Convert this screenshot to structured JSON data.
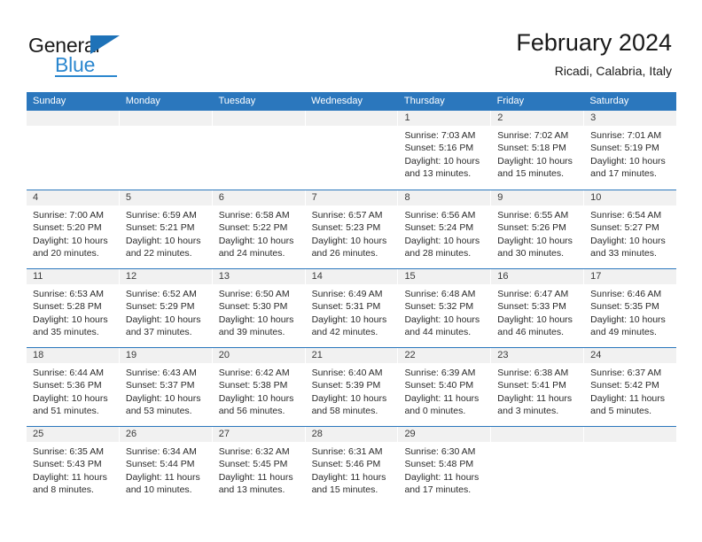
{
  "brand": {
    "name_part1": "General",
    "name_part2": "Blue",
    "triangle_color": "#1e72b8",
    "blue_color": "#2b87cf"
  },
  "header": {
    "title": "February 2024",
    "subtitle": "Ricadi, Calabria, Italy"
  },
  "theme": {
    "header_blue": "#2b77bd",
    "day_band_gray": "#f1f1f1",
    "cell_white": "#ffffff"
  },
  "weekdays": [
    "Sunday",
    "Monday",
    "Tuesday",
    "Wednesday",
    "Thursday",
    "Friday",
    "Saturday"
  ],
  "weeks": [
    [
      {
        "day": "",
        "sunrise": "",
        "sunset": "",
        "daylight": "",
        "daylight2": ""
      },
      {
        "day": "",
        "sunrise": "",
        "sunset": "",
        "daylight": "",
        "daylight2": ""
      },
      {
        "day": "",
        "sunrise": "",
        "sunset": "",
        "daylight": "",
        "daylight2": ""
      },
      {
        "day": "",
        "sunrise": "",
        "sunset": "",
        "daylight": "",
        "daylight2": ""
      },
      {
        "day": "1",
        "sunrise": "Sunrise: 7:03 AM",
        "sunset": "Sunset: 5:16 PM",
        "daylight": "Daylight: 10 hours",
        "daylight2": "and 13 minutes."
      },
      {
        "day": "2",
        "sunrise": "Sunrise: 7:02 AM",
        "sunset": "Sunset: 5:18 PM",
        "daylight": "Daylight: 10 hours",
        "daylight2": "and 15 minutes."
      },
      {
        "day": "3",
        "sunrise": "Sunrise: 7:01 AM",
        "sunset": "Sunset: 5:19 PM",
        "daylight": "Daylight: 10 hours",
        "daylight2": "and 17 minutes."
      }
    ],
    [
      {
        "day": "4",
        "sunrise": "Sunrise: 7:00 AM",
        "sunset": "Sunset: 5:20 PM",
        "daylight": "Daylight: 10 hours",
        "daylight2": "and 20 minutes."
      },
      {
        "day": "5",
        "sunrise": "Sunrise: 6:59 AM",
        "sunset": "Sunset: 5:21 PM",
        "daylight": "Daylight: 10 hours",
        "daylight2": "and 22 minutes."
      },
      {
        "day": "6",
        "sunrise": "Sunrise: 6:58 AM",
        "sunset": "Sunset: 5:22 PM",
        "daylight": "Daylight: 10 hours",
        "daylight2": "and 24 minutes."
      },
      {
        "day": "7",
        "sunrise": "Sunrise: 6:57 AM",
        "sunset": "Sunset: 5:23 PM",
        "daylight": "Daylight: 10 hours",
        "daylight2": "and 26 minutes."
      },
      {
        "day": "8",
        "sunrise": "Sunrise: 6:56 AM",
        "sunset": "Sunset: 5:24 PM",
        "daylight": "Daylight: 10 hours",
        "daylight2": "and 28 minutes."
      },
      {
        "day": "9",
        "sunrise": "Sunrise: 6:55 AM",
        "sunset": "Sunset: 5:26 PM",
        "daylight": "Daylight: 10 hours",
        "daylight2": "and 30 minutes."
      },
      {
        "day": "10",
        "sunrise": "Sunrise: 6:54 AM",
        "sunset": "Sunset: 5:27 PM",
        "daylight": "Daylight: 10 hours",
        "daylight2": "and 33 minutes."
      }
    ],
    [
      {
        "day": "11",
        "sunrise": "Sunrise: 6:53 AM",
        "sunset": "Sunset: 5:28 PM",
        "daylight": "Daylight: 10 hours",
        "daylight2": "and 35 minutes."
      },
      {
        "day": "12",
        "sunrise": "Sunrise: 6:52 AM",
        "sunset": "Sunset: 5:29 PM",
        "daylight": "Daylight: 10 hours",
        "daylight2": "and 37 minutes."
      },
      {
        "day": "13",
        "sunrise": "Sunrise: 6:50 AM",
        "sunset": "Sunset: 5:30 PM",
        "daylight": "Daylight: 10 hours",
        "daylight2": "and 39 minutes."
      },
      {
        "day": "14",
        "sunrise": "Sunrise: 6:49 AM",
        "sunset": "Sunset: 5:31 PM",
        "daylight": "Daylight: 10 hours",
        "daylight2": "and 42 minutes."
      },
      {
        "day": "15",
        "sunrise": "Sunrise: 6:48 AM",
        "sunset": "Sunset: 5:32 PM",
        "daylight": "Daylight: 10 hours",
        "daylight2": "and 44 minutes."
      },
      {
        "day": "16",
        "sunrise": "Sunrise: 6:47 AM",
        "sunset": "Sunset: 5:33 PM",
        "daylight": "Daylight: 10 hours",
        "daylight2": "and 46 minutes."
      },
      {
        "day": "17",
        "sunrise": "Sunrise: 6:46 AM",
        "sunset": "Sunset: 5:35 PM",
        "daylight": "Daylight: 10 hours",
        "daylight2": "and 49 minutes."
      }
    ],
    [
      {
        "day": "18",
        "sunrise": "Sunrise: 6:44 AM",
        "sunset": "Sunset: 5:36 PM",
        "daylight": "Daylight: 10 hours",
        "daylight2": "and 51 minutes."
      },
      {
        "day": "19",
        "sunrise": "Sunrise: 6:43 AM",
        "sunset": "Sunset: 5:37 PM",
        "daylight": "Daylight: 10 hours",
        "daylight2": "and 53 minutes."
      },
      {
        "day": "20",
        "sunrise": "Sunrise: 6:42 AM",
        "sunset": "Sunset: 5:38 PM",
        "daylight": "Daylight: 10 hours",
        "daylight2": "and 56 minutes."
      },
      {
        "day": "21",
        "sunrise": "Sunrise: 6:40 AM",
        "sunset": "Sunset: 5:39 PM",
        "daylight": "Daylight: 10 hours",
        "daylight2": "and 58 minutes."
      },
      {
        "day": "22",
        "sunrise": "Sunrise: 6:39 AM",
        "sunset": "Sunset: 5:40 PM",
        "daylight": "Daylight: 11 hours",
        "daylight2": "and 0 minutes."
      },
      {
        "day": "23",
        "sunrise": "Sunrise: 6:38 AM",
        "sunset": "Sunset: 5:41 PM",
        "daylight": "Daylight: 11 hours",
        "daylight2": "and 3 minutes."
      },
      {
        "day": "24",
        "sunrise": "Sunrise: 6:37 AM",
        "sunset": "Sunset: 5:42 PM",
        "daylight": "Daylight: 11 hours",
        "daylight2": "and 5 minutes."
      }
    ],
    [
      {
        "day": "25",
        "sunrise": "Sunrise: 6:35 AM",
        "sunset": "Sunset: 5:43 PM",
        "daylight": "Daylight: 11 hours",
        "daylight2": "and 8 minutes."
      },
      {
        "day": "26",
        "sunrise": "Sunrise: 6:34 AM",
        "sunset": "Sunset: 5:44 PM",
        "daylight": "Daylight: 11 hours",
        "daylight2": "and 10 minutes."
      },
      {
        "day": "27",
        "sunrise": "Sunrise: 6:32 AM",
        "sunset": "Sunset: 5:45 PM",
        "daylight": "Daylight: 11 hours",
        "daylight2": "and 13 minutes."
      },
      {
        "day": "28",
        "sunrise": "Sunrise: 6:31 AM",
        "sunset": "Sunset: 5:46 PM",
        "daylight": "Daylight: 11 hours",
        "daylight2": "and 15 minutes."
      },
      {
        "day": "29",
        "sunrise": "Sunrise: 6:30 AM",
        "sunset": "Sunset: 5:48 PM",
        "daylight": "Daylight: 11 hours",
        "daylight2": "and 17 minutes."
      },
      {
        "day": "",
        "sunrise": "",
        "sunset": "",
        "daylight": "",
        "daylight2": ""
      },
      {
        "day": "",
        "sunrise": "",
        "sunset": "",
        "daylight": "",
        "daylight2": ""
      }
    ]
  ]
}
